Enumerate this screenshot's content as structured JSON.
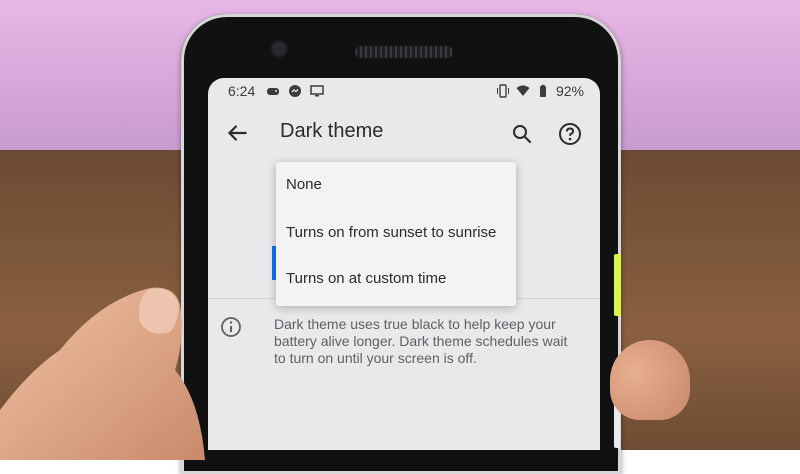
{
  "status_bar": {
    "time": "6:24",
    "battery": "92%",
    "left_icons": [
      "game-icon",
      "messenger-icon",
      "cast-icon"
    ],
    "right_icons": [
      "vibrate-icon",
      "wifi-icon",
      "battery-icon"
    ]
  },
  "app_bar": {
    "title": "Dark theme",
    "back_icon": "arrow-back-icon",
    "search_icon": "search-icon",
    "help_icon": "help-icon"
  },
  "menu": {
    "items": [
      {
        "label": "None"
      },
      {
        "label": "Turns on from sunset to sunrise"
      },
      {
        "label": "Turns on at custom time"
      }
    ]
  },
  "info": {
    "text": "Dark theme uses true black to help keep your battery alive longer. Dark theme schedules wait to turn on until your screen is off."
  },
  "colors": {
    "accent": "#1a6df0",
    "screen_bg": "#e9e9eb",
    "menu_bg": "#f3f3f4",
    "side_button": "#d9f54a"
  }
}
